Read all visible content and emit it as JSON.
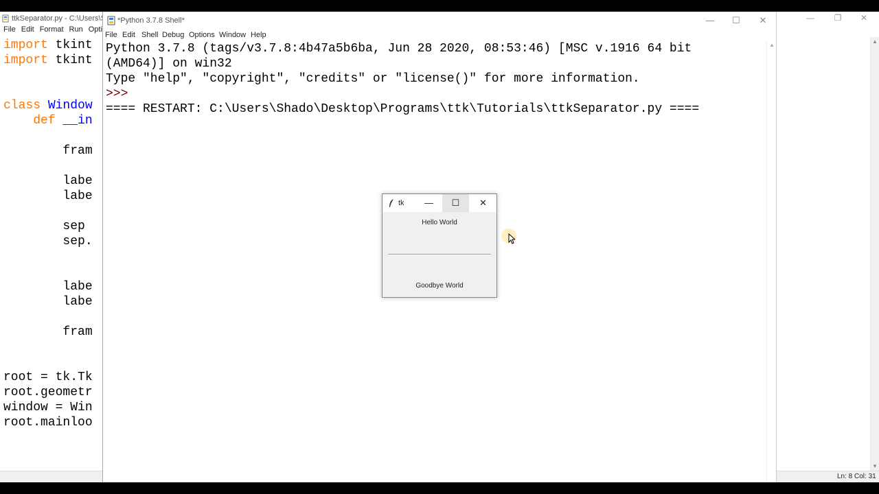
{
  "editor": {
    "title": "ttkSeparator.py - C:\\Users\\Sha",
    "menu": [
      "File",
      "Edit",
      "Format",
      "Run",
      "Optio"
    ],
    "code_lines": [
      {
        "kw": "import",
        "rest": " tkint",
        "indent": ""
      },
      {
        "kw": "import",
        "rest": " tkint",
        "indent": ""
      },
      {
        "kw": "",
        "rest": "",
        "indent": ""
      },
      {
        "kw": "",
        "rest": "",
        "indent": ""
      },
      {
        "kw": "class",
        "def": " Window",
        "rest": "",
        "indent": ""
      },
      {
        "kw": "def",
        "def": " __in",
        "rest": "",
        "indent": "    "
      },
      {
        "kw": "",
        "rest": "",
        "indent": ""
      },
      {
        "kw": "",
        "rest": "fram",
        "indent": "        "
      },
      {
        "kw": "",
        "rest": "",
        "indent": ""
      },
      {
        "kw": "",
        "rest": "labe",
        "indent": "        "
      },
      {
        "kw": "",
        "rest": "labe",
        "indent": "        "
      },
      {
        "kw": "",
        "rest": "",
        "indent": ""
      },
      {
        "kw": "",
        "rest": "sep ",
        "indent": "        "
      },
      {
        "kw": "",
        "rest": "sep.",
        "indent": "        "
      },
      {
        "kw": "",
        "rest": "",
        "indent": ""
      },
      {
        "kw": "",
        "rest": "",
        "indent": ""
      },
      {
        "kw": "",
        "rest": "labe",
        "indent": "        "
      },
      {
        "kw": "",
        "rest": "labe",
        "indent": "        "
      },
      {
        "kw": "",
        "rest": "",
        "indent": ""
      },
      {
        "kw": "",
        "rest": "fram",
        "indent": "        "
      },
      {
        "kw": "",
        "rest": "",
        "indent": ""
      },
      {
        "kw": "",
        "rest": "",
        "indent": ""
      },
      {
        "kw": "",
        "rest": "root = tk.Tk",
        "indent": ""
      },
      {
        "kw": "",
        "rest": "root.geometr",
        "indent": ""
      },
      {
        "kw": "",
        "rest": "window = Win",
        "indent": ""
      },
      {
        "kw": "",
        "rest": "root.mainloo",
        "indent": ""
      }
    ],
    "status": "Ln: 8   Col: 31"
  },
  "shell": {
    "title": "*Python 3.7.8 Shell*",
    "menu": [
      "File",
      "Edit",
      "Shell",
      "Debug",
      "Options",
      "Window",
      "Help"
    ],
    "output_lines": [
      {
        "text": "Python 3.7.8 (tags/v3.7.8:4b47a5b6ba, Jun 28 2020, 08:53:46) [MSC v.1916 64 bit",
        "cls": ""
      },
      {
        "text": "(AMD64)] on win32",
        "cls": ""
      },
      {
        "text": "Type \"help\", \"copyright\", \"credits\" or \"license()\" for more information.",
        "cls": ""
      },
      {
        "text": ">>>",
        "cls": "prompt"
      },
      {
        "text": "==== RESTART: C:\\Users\\Shado\\Desktop\\Programs\\ttk\\Tutorials\\ttkSeparator.py ====",
        "cls": "restart"
      }
    ]
  },
  "tk_window": {
    "title": "tk",
    "label_top": "Hello World",
    "label_bottom": "Goodbye World"
  },
  "colors": {
    "keyword": "#ff7700",
    "definition": "#0000ff",
    "prompt": "#770000"
  }
}
